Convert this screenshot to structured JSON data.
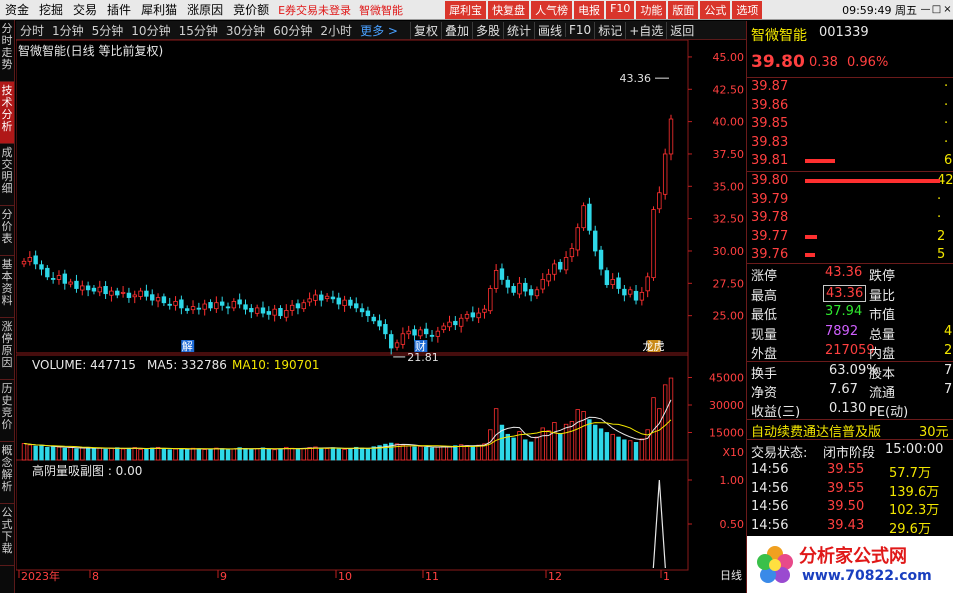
{
  "menu": {
    "items": [
      "资金",
      "挖掘",
      "交易",
      "插件",
      "犀利猫",
      "涨原因",
      "竞价额"
    ],
    "notice": "E券交易未登录",
    "stock_name": "智微智能",
    "red_buttons": [
      "犀利宝",
      "快复盘",
      "人气榜",
      "电报",
      "F10",
      "功能",
      "版面",
      "公式",
      "选项"
    ],
    "clock": "09:59:49 周五"
  },
  "left_tabs": [
    {
      "label": "分时走势",
      "active": false
    },
    {
      "label": "技术分析",
      "active": true
    },
    {
      "label": "成交明细",
      "active": false
    },
    {
      "label": "分价表",
      "active": false
    },
    {
      "label": "基本资料",
      "active": false
    },
    {
      "label": "涨停原因",
      "active": false
    },
    {
      "label": "历史竞价",
      "active": false
    },
    {
      "label": "概念解析",
      "active": false
    },
    {
      "label": "公式下载",
      "active": false
    }
  ],
  "toolbar": {
    "periods": [
      "分时",
      "1分钟",
      "5分钟",
      "10分钟",
      "15分钟",
      "30分钟",
      "60分钟",
      "2小时"
    ],
    "more": "更多 >",
    "tools": [
      "复权",
      "叠加",
      "多股",
      "统计",
      "画线",
      "F10",
      "标记",
      "+自选",
      "返回"
    ]
  },
  "chart_data": {
    "type": "candlestick",
    "title": "智微智能(日线 等比前复权)",
    "y_ticks": [
      "45.00",
      "42.50",
      "40.00",
      "37.50",
      "35.00",
      "32.50",
      "30.00",
      "27.50",
      "25.00"
    ],
    "ylim": [
      22.5,
      46.0
    ],
    "max_label": "43.36",
    "min_label": "21.81",
    "markers": [
      "解",
      "财",
      "龙虎"
    ],
    "x_labels": [
      "2023年",
      "8",
      "9",
      "10",
      "11",
      "12",
      "1",
      "日线"
    ],
    "closes": [
      29.2,
      29.5,
      29.0,
      28.6,
      28.0,
      27.8,
      28.1,
      27.5,
      27.6,
      27.1,
      27.3,
      27.0,
      26.9,
      27.2,
      26.7,
      26.9,
      26.6,
      26.8,
      26.4,
      26.6,
      26.9,
      26.5,
      26.2,
      26.4,
      26.0,
      25.8,
      26.1,
      25.6,
      25.4,
      25.7,
      25.5,
      25.9,
      25.6,
      26.0,
      25.8,
      25.6,
      26.1,
      25.9,
      25.5,
      25.3,
      25.6,
      25.2,
      25.1,
      25.5,
      25.0,
      25.4,
      25.8,
      25.6,
      26.0,
      26.3,
      26.6,
      26.2,
      26.5,
      26.3,
      25.9,
      26.2,
      25.8,
      25.6,
      25.3,
      25.0,
      24.6,
      24.2,
      23.6,
      22.5,
      22.9,
      23.6,
      23.8,
      23.5,
      23.9,
      23.6,
      23.4,
      23.8,
      24.2,
      24.5,
      24.3,
      24.8,
      25.1,
      24.9,
      25.2,
      25.5,
      27.1,
      28.5,
      27.8,
      27.2,
      26.8,
      27.5,
      26.9,
      26.6,
      27.0,
      27.8,
      28.2,
      29.0,
      28.6,
      29.5,
      30.2,
      31.8,
      33.5,
      31.6,
      30.0,
      28.6,
      27.4,
      27.8,
      27.1,
      26.6,
      27.0,
      26.2,
      26.8,
      28.0,
      33.2,
      34.5,
      37.5,
      40.2
    ],
    "volume_indicator": {
      "label": "VOLUME: 447715",
      "ma5_label": "MA5: 332786",
      "ma10_label": "MA10: 190701",
      "y_ticks": [
        "45000",
        "30000",
        "15000"
      ],
      "unit": "X10",
      "values": [
        9000,
        8200,
        7500,
        7800,
        6900,
        7200,
        7000,
        6400,
        6800,
        6100,
        6500,
        6900,
        6200,
        6600,
        5900,
        6300,
        6700,
        6000,
        6400,
        6800,
        5800,
        6100,
        6500,
        6900,
        6200,
        5600,
        6000,
        6300,
        5800,
        6400,
        6100,
        5700,
        6000,
        6500,
        6200,
        5600,
        6100,
        6700,
        6300,
        5800,
        6200,
        6600,
        6000,
        5600,
        6100,
        6900,
        6400,
        6000,
        6300,
        6800,
        7100,
        6500,
        6200,
        6700,
        6100,
        5800,
        6300,
        6900,
        6500,
        6100,
        7200,
        7800,
        8600,
        9200,
        8800,
        8200,
        7600,
        7100,
        7400,
        6900,
        6600,
        7100,
        7600,
        7200,
        7800,
        8300,
        7900,
        7500,
        8100,
        8800,
        16500,
        28000,
        19000,
        14000,
        12000,
        15500,
        11000,
        9800,
        12500,
        17500,
        16000,
        20500,
        14500,
        19500,
        21000,
        27500,
        26500,
        22000,
        19000,
        17000,
        15000,
        14000,
        12500,
        11000,
        10500,
        9600,
        11500,
        16500,
        34000,
        28000,
        41000,
        44700
      ]
    },
    "sub_indicator": {
      "label": "高阴量吸副图 : 0.00",
      "y_ticks": [
        "1.00",
        "0.50"
      ]
    }
  },
  "quote": {
    "name": "智微智能",
    "code": "001339",
    "price": "39.80",
    "change": "0.38",
    "change_pct": "0.96%",
    "asks": [
      {
        "price": "39.87",
        "vol": "·"
      },
      {
        "price": "39.86",
        "vol": "·"
      },
      {
        "price": "39.85",
        "vol": "·"
      },
      {
        "price": "39.83",
        "vol": "·"
      },
      {
        "price": "39.81",
        "vol": "6"
      }
    ],
    "bids": [
      {
        "price": "39.80",
        "vol": "42"
      },
      {
        "price": "39.79",
        "vol": "·"
      },
      {
        "price": "39.78",
        "vol": "·"
      },
      {
        "price": "39.77",
        "vol": "2"
      },
      {
        "price": "39.76",
        "vol": "5"
      }
    ],
    "stats": [
      {
        "k1": "涨停",
        "v1": "43.36",
        "k2": "跌停",
        "c": "red"
      },
      {
        "k1": "最高",
        "v1": "43.36",
        "k2": "量比",
        "c": "red"
      },
      {
        "k1": "最低",
        "v1": "37.94",
        "k2": "市值",
        "c": "green"
      },
      {
        "k1": "现量",
        "v1": "7892",
        "k2": "总量",
        "v2": "4",
        "c": "purple"
      },
      {
        "k1": "外盘",
        "v1": "217059",
        "k2": "内盘",
        "v2": "2",
        "c": "red"
      }
    ],
    "stats2": [
      {
        "k1": "换手",
        "v1": "63.09%",
        "k2": "股本",
        "v2": "7"
      },
      {
        "k1": "净资",
        "v1": "7.67",
        "k2": "流通",
        "v2": "7"
      },
      {
        "k1": "收益(三)",
        "v1": "0.130",
        "k2": "PE(动)",
        "v2": ""
      }
    ],
    "promo": "自动续费通达信普及版",
    "promo_right": "30元",
    "trade_state_label": "交易状态:",
    "trade_state": "闭市阶段",
    "trade_time": "15:00:00",
    "ticks": [
      {
        "time": "14:56",
        "price": "39.55",
        "vol": "57.7万"
      },
      {
        "time": "14:56",
        "price": "39.55",
        "vol": "139.6万"
      },
      {
        "time": "14:56",
        "price": "39.50",
        "vol": "102.3万"
      },
      {
        "time": "14:56",
        "price": "39.43",
        "vol": "29.6万"
      }
    ],
    "logo_text": "分析家公式网",
    "logo_url": "www.70822.com"
  }
}
